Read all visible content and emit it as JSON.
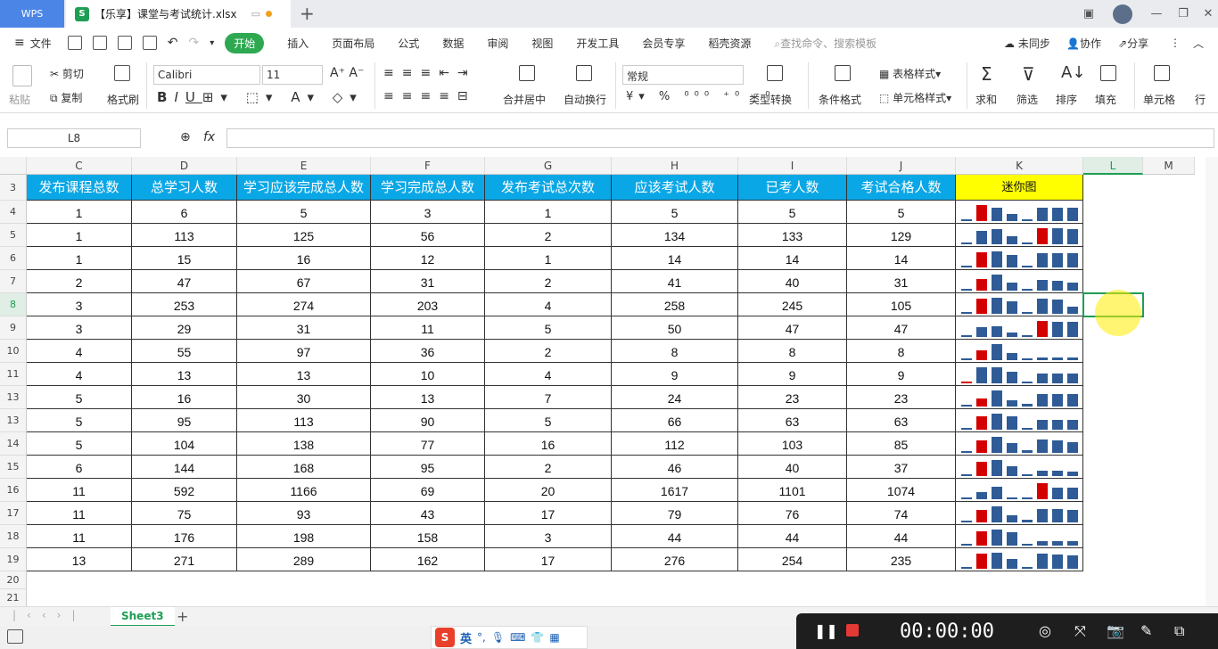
{
  "titlebar": {
    "app_tab": "WPS",
    "doc_tab": "【乐享】课堂与考试统计.xlsx",
    "new_tab": "+"
  },
  "menu": {
    "file": "文件",
    "items": [
      "开始",
      "插入",
      "页面布局",
      "公式",
      "数据",
      "审阅",
      "视图",
      "开发工具",
      "会员专享",
      "稻壳资源"
    ],
    "search": "查找命令、搜索模板",
    "right": [
      "未同步",
      "协作",
      "分享"
    ]
  },
  "ribbon": {
    "paste": "粘贴",
    "cut": "剪切",
    "copy": "复制",
    "format_painter": "格式刷",
    "font_name": "Calibri",
    "font_size": "11",
    "merge_center": "合并居中",
    "auto_wrap": "自动换行",
    "number_format": "常规",
    "type_convert": "类型转换",
    "cond_format": "条件格式",
    "table_style": "表格样式",
    "cell_style": "单元格样式",
    "sum": "求和",
    "filter": "筛选",
    "sort": "排序",
    "fill": "填充",
    "cells": "单元格",
    "rowcol": "行"
  },
  "formula_bar": {
    "name_box": "L8",
    "fx": "fx",
    "value": ""
  },
  "columns": [
    "C",
    "D",
    "E",
    "F",
    "G",
    "H",
    "I",
    "J",
    "K",
    "L",
    "M"
  ],
  "header_row": {
    "row_num": "3",
    "labels": [
      "发布课程总数",
      "总学习人数",
      "学习应该完成总人数",
      "学习完成总人数",
      "发布考试总次数",
      "应该考试人数",
      "已考人数",
      "考试合格人数",
      "迷你图"
    ]
  },
  "rows": [
    {
      "n": "4",
      "v": [
        "1",
        "6",
        "5",
        "3",
        "1",
        "5",
        "5",
        "5"
      ],
      "hi": 1
    },
    {
      "n": "5",
      "v": [
        "1",
        "113",
        "125",
        "56",
        "2",
        "134",
        "133",
        "129"
      ],
      "hi": 5
    },
    {
      "n": "6",
      "v": [
        "1",
        "15",
        "16",
        "12",
        "1",
        "14",
        "14",
        "14"
      ],
      "hi": 1
    },
    {
      "n": "7",
      "v": [
        "2",
        "47",
        "67",
        "31",
        "2",
        "41",
        "40",
        "31"
      ],
      "hi": 1
    },
    {
      "n": "8",
      "v": [
        "3",
        "253",
        "274",
        "203",
        "4",
        "258",
        "245",
        "105"
      ],
      "hi": 1
    },
    {
      "n": "9",
      "v": [
        "3",
        "29",
        "31",
        "11",
        "5",
        "50",
        "47",
        "47"
      ],
      "hi": 5
    },
    {
      "n": "10",
      "v": [
        "4",
        "55",
        "97",
        "36",
        "2",
        "8",
        "8",
        "8"
      ],
      "hi": 1
    },
    {
      "n": "11",
      "v": [
        "4",
        "13",
        "13",
        "10",
        "4",
        "9",
        "9",
        "9"
      ],
      "hi": 0
    },
    {
      "n": "13",
      "v": [
        "5",
        "16",
        "30",
        "13",
        "7",
        "24",
        "23",
        "23"
      ],
      "hi": 1
    },
    {
      "n": "13",
      "v": [
        "5",
        "95",
        "113",
        "90",
        "5",
        "66",
        "63",
        "63"
      ],
      "hi": 1
    },
    {
      "n": "14",
      "v": [
        "5",
        "104",
        "138",
        "77",
        "16",
        "112",
        "103",
        "85"
      ],
      "hi": 1
    },
    {
      "n": "15",
      "v": [
        "6",
        "144",
        "168",
        "95",
        "2",
        "46",
        "40",
        "37"
      ],
      "hi": 1
    },
    {
      "n": "16",
      "v": [
        "11",
        "592",
        "1166",
        "69",
        "20",
        "1617",
        "1101",
        "1074"
      ],
      "hi": 5
    },
    {
      "n": "17",
      "v": [
        "11",
        "75",
        "93",
        "43",
        "17",
        "79",
        "76",
        "74"
      ],
      "hi": 1
    },
    {
      "n": "18",
      "v": [
        "11",
        "176",
        "198",
        "158",
        "3",
        "44",
        "44",
        "44"
      ],
      "hi": 1
    },
    {
      "n": "19",
      "v": [
        "13",
        "271",
        "289",
        "162",
        "17",
        "276",
        "254",
        "235"
      ],
      "hi": 1
    }
  ],
  "extra_rows": [
    "20",
    "21"
  ],
  "sheet": {
    "tab": "Sheet3",
    "add": "+"
  },
  "ime": {
    "lang": "英"
  },
  "recorder": {
    "time": "00:00:00"
  },
  "colors": {
    "header_bg": "#0aa7e6",
    "mini_header": "#ffff00",
    "bar_blue": "#2f5b96",
    "bar_red": "#d40000",
    "selection": "#1e9e54"
  }
}
